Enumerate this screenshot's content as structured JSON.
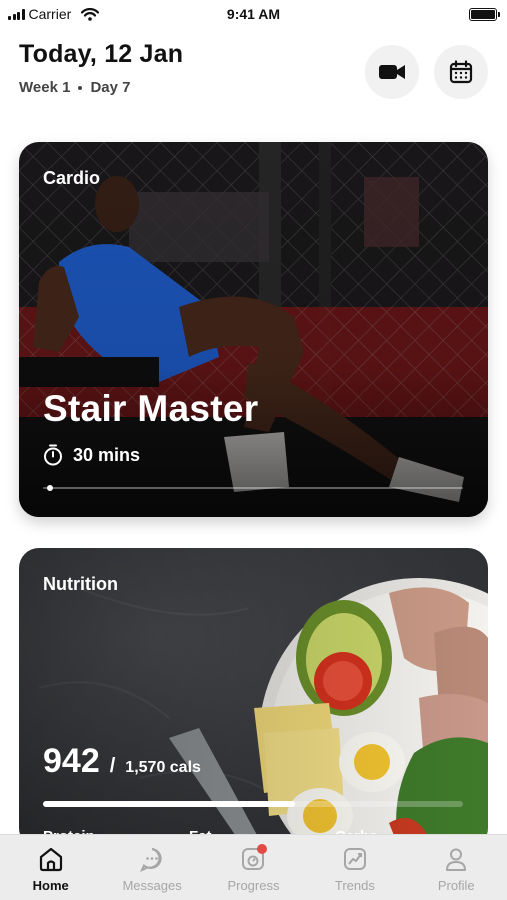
{
  "status_bar": {
    "carrier": "Carrier",
    "time": "9:41 AM"
  },
  "header": {
    "title": "Today, 12 Jan",
    "week": "Week 1",
    "day": "Day 7",
    "actions": [
      "video-camera-icon",
      "calendar-icon"
    ]
  },
  "cardio_card": {
    "category": "Cardio",
    "title": "Stair Master",
    "duration": "30 mins",
    "progress": 0.01,
    "image": "woman exercising in gym"
  },
  "nutrition_card": {
    "category": "Nutrition",
    "calories_eaten": "942",
    "calories_target": "1,570 cals",
    "progress": 0.6,
    "macros": [
      "Protein",
      "Fat",
      "Carbs"
    ],
    "image": "salad bowl with avocado, tomato, egg, cheese and sliced meat"
  },
  "tab_bar": {
    "tabs": [
      {
        "label": "Home",
        "icon": "home-icon",
        "active": true
      },
      {
        "label": "Messages",
        "icon": "chat-icon",
        "active": false
      },
      {
        "label": "Progress",
        "icon": "progress-icon",
        "active": false,
        "badge": true
      },
      {
        "label": "Trends",
        "icon": "trends-icon",
        "active": false
      },
      {
        "label": "Profile",
        "icon": "profile-icon",
        "active": false
      }
    ]
  },
  "colors": {
    "badge": "#e44a45",
    "tab_inactive": "#a6a6a6",
    "tab_active": "#111111"
  }
}
